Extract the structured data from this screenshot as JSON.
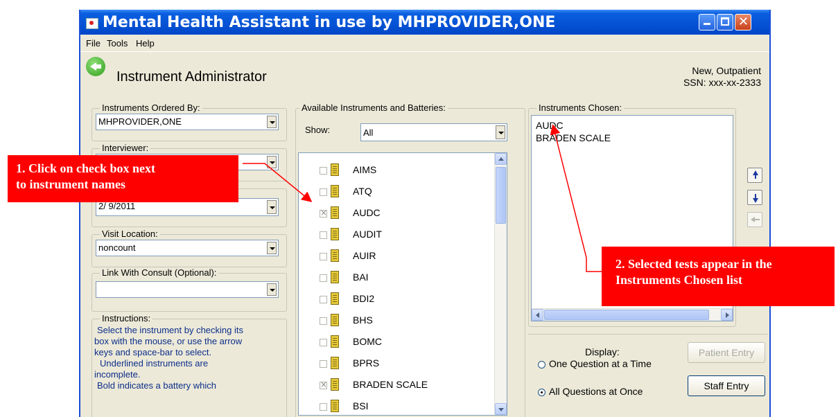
{
  "window": {
    "title": "Mental Health Assistant in use by MHPROVIDER,ONE",
    "menu": [
      "File",
      "Tools",
      "Help"
    ]
  },
  "header": {
    "title": "Instrument Administrator",
    "patient_status": "New, Outpatient",
    "ssn": "SSN: xxx-xx-2333"
  },
  "left": {
    "ordered_by_label": "Instruments Ordered By:",
    "ordered_by_value": "MHPROVIDER,ONE",
    "interviewer_label": "Interviewer:",
    "date_value": "2/ 9/2011",
    "visit_location_label": "Visit Location:",
    "visit_location_value": "noncount",
    "consult_label": "Link With Consult (Optional):",
    "consult_value": "",
    "instructions_label": "Instructions:",
    "instructions_lines": [
      "Select the instrument by checking its",
      "box with the mouse, or use the arrow",
      "keys and space-bar to select.",
      "Underlined instruments are",
      "incomplete.",
      "Bold indicates a battery which"
    ]
  },
  "available": {
    "label": "Available Instruments and Batteries:",
    "show_label": "Show:",
    "show_value": "All",
    "items": [
      {
        "name": "AIMS",
        "checked": false
      },
      {
        "name": "ATQ",
        "checked": false
      },
      {
        "name": "AUDC",
        "checked": true
      },
      {
        "name": "AUDIT",
        "checked": false
      },
      {
        "name": "AUIR",
        "checked": false
      },
      {
        "name": "BAI",
        "checked": false
      },
      {
        "name": "BDI2",
        "checked": false
      },
      {
        "name": "BHS",
        "checked": false
      },
      {
        "name": "BOMC",
        "checked": false
      },
      {
        "name": "BPRS",
        "checked": false
      },
      {
        "name": "BRADEN SCALE",
        "checked": true
      },
      {
        "name": "BSI",
        "checked": false
      }
    ]
  },
  "chosen": {
    "label": "Instruments Chosen:",
    "items": [
      "AUDC",
      "BRADEN SCALE"
    ]
  },
  "display": {
    "label": "Display:",
    "option_one": "One Question at a Time",
    "option_all": "All Questions at Once",
    "selected": "all"
  },
  "buttons": {
    "patient_entry": "Patient Entry",
    "staff_entry": "Staff Entry"
  },
  "annotations": {
    "callout1": [
      "1. Click on check box next",
      "to instrument names"
    ],
    "callout2": [
      "2. Selected tests appear in the",
      "Instruments  Chosen list"
    ],
    "callout_color": "#ff0000"
  }
}
